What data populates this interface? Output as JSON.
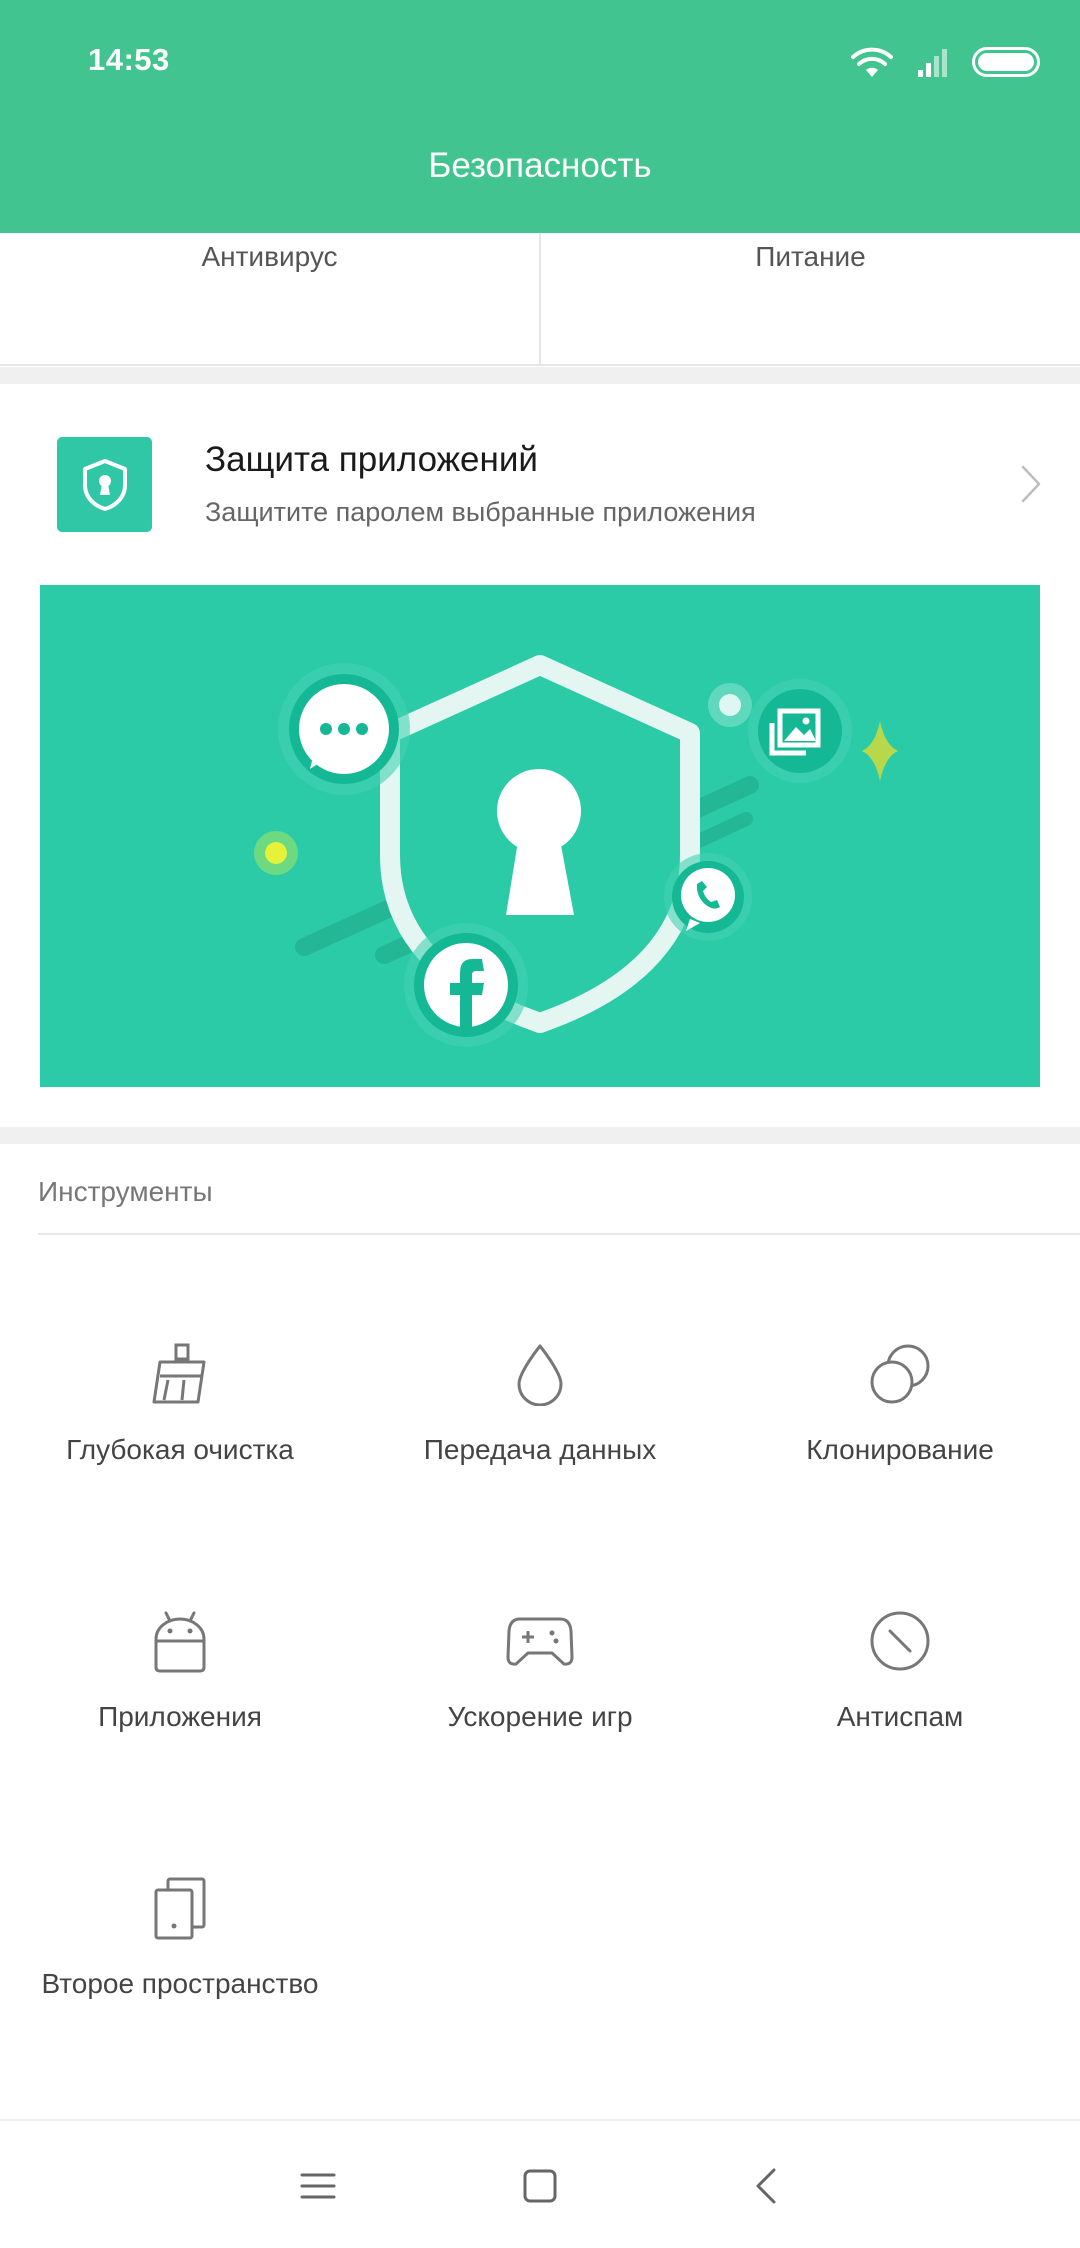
{
  "status_bar": {
    "time": "14:53"
  },
  "header": {
    "title": "Безопасность"
  },
  "top_cards": [
    {
      "label": "Антивирус"
    },
    {
      "label": "Питание"
    }
  ],
  "feature": {
    "title": "Защита приложений",
    "subtitle": "Защитите паролем выбранные приложения",
    "icon": "shield-lock-icon"
  },
  "tools": {
    "title": "Инструменты",
    "items": [
      {
        "label": "Глубокая очистка",
        "icon": "broom-icon"
      },
      {
        "label": "Передача данных",
        "icon": "drop-icon"
      },
      {
        "label": "Клонирование",
        "icon": "clone-icon"
      },
      {
        "label": "Приложения",
        "icon": "android-icon"
      },
      {
        "label": "Ускорение игр",
        "icon": "gamepad-icon"
      },
      {
        "label": "Антиспам",
        "icon": "block-icon"
      },
      {
        "label": "Второе пространство",
        "icon": "second-space-icon"
      }
    ]
  },
  "colors": {
    "accent": "#41c48f",
    "banner": "#2bcba8"
  }
}
